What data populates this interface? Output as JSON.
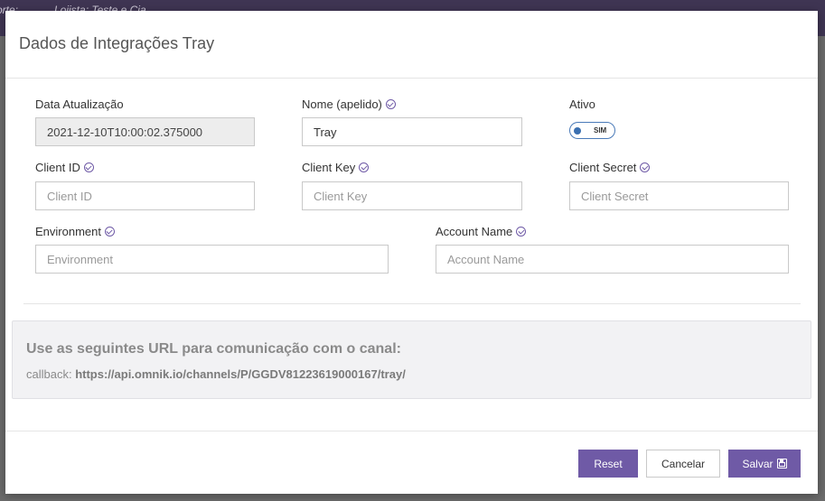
{
  "background": {
    "breadcrumb_1": "orte:",
    "breadcrumb_2": "Lojista: Teste e Cia"
  },
  "modal": {
    "title": "Dados de Integrações Tray",
    "fields": {
      "data_atualizacao": {
        "label": "Data Atualização",
        "value": "2021-12-10T10:00:02.375000"
      },
      "nome": {
        "label": "Nome (apelido)",
        "value": "Tray"
      },
      "ativo": {
        "label": "Ativo",
        "toggle_text": "SIM",
        "checked": true
      },
      "client_id": {
        "label": "Client ID",
        "placeholder": "Client ID",
        "value": ""
      },
      "client_key": {
        "label": "Client Key",
        "placeholder": "Client Key",
        "value": ""
      },
      "client_secret": {
        "label": "Client Secret",
        "placeholder": "Client Secret",
        "value": ""
      },
      "environment": {
        "label": "Environment",
        "placeholder": "Environment",
        "value": ""
      },
      "account_name": {
        "label": "Account Name",
        "placeholder": "Account Name",
        "value": ""
      }
    },
    "info": {
      "title": "Use as seguintes URL para comunicação com o canal:",
      "callback_label": "callback:",
      "callback_url": "https://api.omnik.io/channels/P/GGDV81223619000167/tray/"
    },
    "buttons": {
      "reset": "Reset",
      "cancel": "Cancelar",
      "save": "Salvar"
    }
  },
  "colors": {
    "accent": "#6f5aa6",
    "topbar": "#3f3553"
  }
}
